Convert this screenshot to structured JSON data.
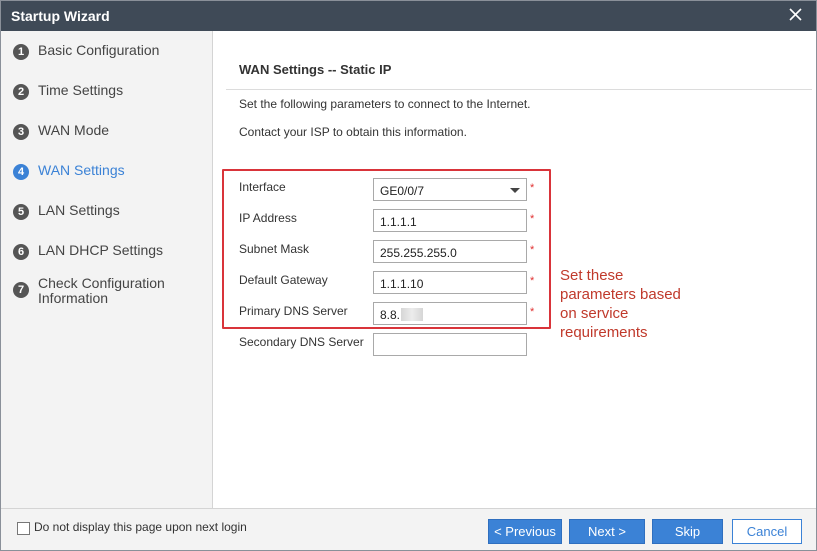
{
  "window": {
    "title": "Startup Wizard"
  },
  "steps": [
    {
      "number": "1",
      "label": "Basic Configuration"
    },
    {
      "number": "2",
      "label": "Time Settings"
    },
    {
      "number": "3",
      "label": "WAN Mode"
    },
    {
      "number": "4",
      "label": "WAN Settings"
    },
    {
      "number": "5",
      "label": "LAN Settings"
    },
    {
      "number": "6",
      "label": "LAN DHCP Settings"
    },
    {
      "number": "7",
      "label": "Check Configuration\nInformation"
    }
  ],
  "active_step": "WAN Settings",
  "main": {
    "title": "WAN Settings -- Static IP",
    "desc1": "Set the following parameters to connect to the Internet.",
    "desc2": "Contact your ISP to obtain this information."
  },
  "form": {
    "interface": {
      "label": "Interface",
      "value": "GE0/0/7"
    },
    "ip_address": {
      "label": "IP Address",
      "value": "1.1.1.1"
    },
    "subnet_mask": {
      "label": "Subnet Mask",
      "value": "255.255.255.0"
    },
    "default_gateway": {
      "label": "Default Gateway",
      "value": "1.1.1.10"
    },
    "primary_dns": {
      "label": "Primary DNS Server",
      "value": "8.8."
    },
    "secondary_dns": {
      "label": "Secondary DNS Server",
      "value": ""
    },
    "required_mark": "*"
  },
  "annotation": "Set these parameters based on service requirements",
  "footer": {
    "checkbox_label": "Do not display this page upon next login",
    "previous": "< Previous",
    "next": "Next >",
    "skip": "Skip",
    "cancel": "Cancel"
  },
  "colors": {
    "accent": "#3b82d6",
    "titlebar": "#3f4a57",
    "highlight": "#d9343a",
    "required": "#e03030"
  }
}
